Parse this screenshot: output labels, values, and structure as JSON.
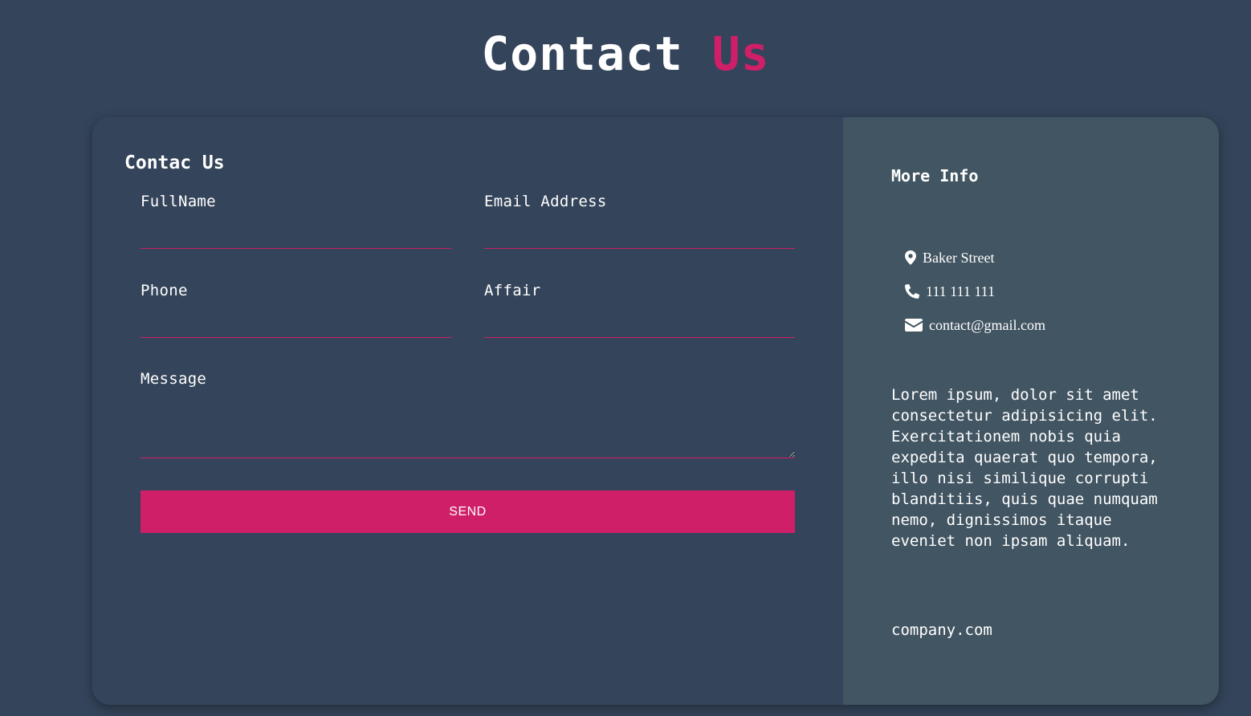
{
  "page_title": {
    "main": "Contact",
    "accent": "Us"
  },
  "colors": {
    "background": "#34445a",
    "info_panel": "#425562",
    "accent": "#cf1f69",
    "text": "#ffffff"
  },
  "form": {
    "heading": "Contac Us",
    "fields": {
      "fullname": {
        "label": "FullName",
        "value": ""
      },
      "email": {
        "label": "Email Address",
        "value": ""
      },
      "phone": {
        "label": "Phone",
        "value": ""
      },
      "affair": {
        "label": "Affair",
        "value": ""
      },
      "message": {
        "label": "Message",
        "value": ""
      }
    },
    "send_label": "SEND"
  },
  "info": {
    "heading": "More Info",
    "contacts": [
      {
        "icon": "map-marker-icon",
        "text": "Baker Street"
      },
      {
        "icon": "phone-icon",
        "text": "111 111 111"
      },
      {
        "icon": "envelope-icon",
        "text": "contact@gmail.com"
      }
    ],
    "description": "Lorem ipsum, dolor sit amet consectetur adipisicing elit. Exercitationem nobis quia expedita quaerat quo tempora, illo nisi similique corrupti blanditiis, quis quae numquam nemo, dignissimos itaque eveniet non ipsam aliquam.",
    "website": "company.com"
  }
}
